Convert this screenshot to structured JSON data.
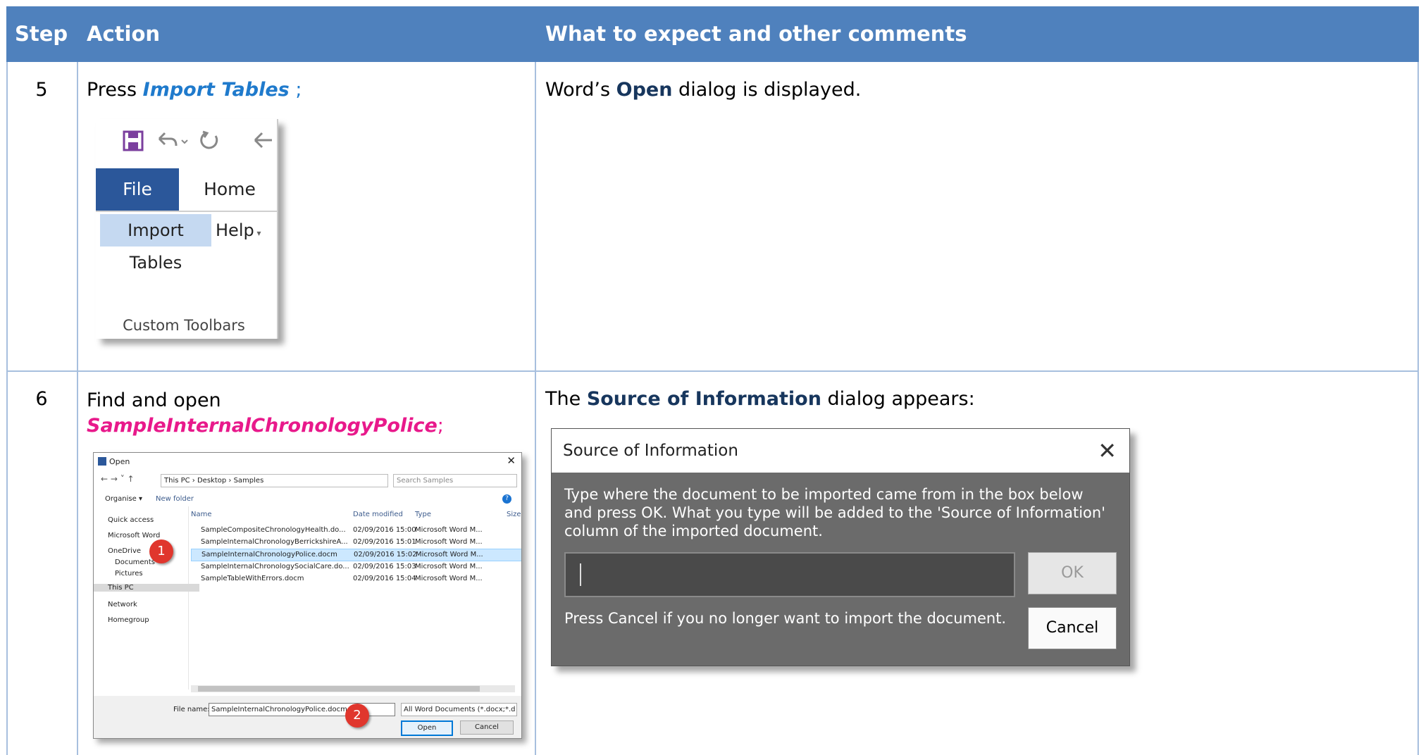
{
  "header": {
    "step": "Step",
    "action": "Action",
    "comments": "What to expect and other comments"
  },
  "rows": [
    {
      "step": "5",
      "action_prefix": "Press ",
      "action_emphasis": "Import Tables",
      "action_suffix": " ;",
      "comment_prefix": "Word’s ",
      "comment_bold": "Open",
      "comment_suffix": " dialog is displayed.",
      "ribbon": {
        "tab_file": "File",
        "tab_home": "Home",
        "import_tables": "Import Tables",
        "help": "Help",
        "group": "Custom Toolbars"
      }
    },
    {
      "step": "6",
      "action_line1": "Find and open",
      "action_emphasis": "SampleInternalChronologyPolice",
      "action_suffix": ";",
      "comment_prefix": "The ",
      "comment_bold": "Source of Information",
      "comment_suffix": " dialog appears:",
      "open_dialog": {
        "title": "Open",
        "address": "This PC  ›  Desktop  ›  Samples",
        "search_placeholder": "Search Samples",
        "organise": "Organise ▾",
        "new_folder": "New folder",
        "nav": [
          "Quick access",
          "Microsoft Word",
          "OneDrive",
          "Documents",
          "Pictures",
          "This PC",
          "Network",
          "Homegroup"
        ],
        "columns": [
          "Name",
          "Date modified",
          "Type",
          "Size"
        ],
        "files": [
          {
            "name": "SampleCompositeChronologyHealth.do...",
            "date": "02/09/2016 15:00",
            "type": "Microsoft Word M..."
          },
          {
            "name": "SampleInternalChronologyBerrickshireA...",
            "date": "02/09/2016 15:01",
            "type": "Microsoft Word M..."
          },
          {
            "name": "SampleInternalChronologyPolice.docm",
            "date": "02/09/2016 15:02",
            "type": "Microsoft Word M..."
          },
          {
            "name": "SampleInternalChronologySocialCare.do...",
            "date": "02/09/2016 15:03",
            "type": "Microsoft Word M..."
          },
          {
            "name": "SampleTableWithErrors.docm",
            "date": "02/09/2016 15:04",
            "type": "Microsoft Word M..."
          }
        ],
        "file_name_label": "File name:",
        "file_name_value": "SampleInternalChronologyPolice.docm",
        "filter": "All Word Documents (*.docx;*.d",
        "open_button": "Open",
        "cancel_button": "Cancel",
        "callout1": "1",
        "callout2": "2"
      },
      "source_dialog": {
        "title": "Source of Information",
        "message": "Type where the document to be imported came from in the box below and press OK. What you type will be added to the 'Source of Information' column of the imported document.",
        "ok": "OK",
        "cancel_message": "Press Cancel if you no longer want to import the document.",
        "cancel": "Cancel"
      }
    }
  ],
  "colors": {
    "header_bg": "#4f81bd",
    "grid": "#a7bfde",
    "emphasis_blue": "#1f7acc",
    "emphasis_magenta": "#e8198b"
  }
}
